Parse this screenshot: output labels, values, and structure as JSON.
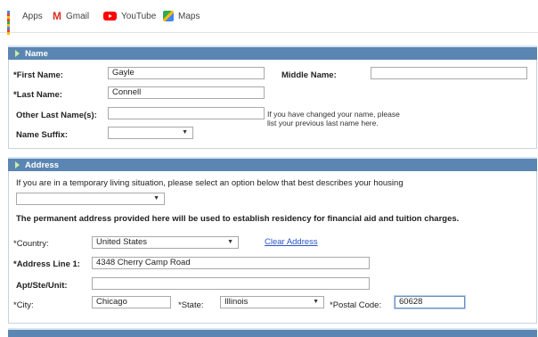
{
  "bookmarks": [
    {
      "label": "Apps",
      "icon": "apps-grid-icon"
    },
    {
      "label": "Gmail",
      "icon": "gmail-icon"
    },
    {
      "label": "YouTube",
      "icon": "youtube-icon"
    },
    {
      "label": "Maps",
      "icon": "maps-icon"
    }
  ],
  "name_section": {
    "title": "Name",
    "first_name_label": "*First Name:",
    "first_name_value": "Gayle",
    "middle_name_label": "Middle Name:",
    "middle_name_value": "",
    "last_name_label": "*Last Name:",
    "last_name_value": "Connell",
    "other_last_names_label": "Other Last Name(s):",
    "other_last_names_value": "",
    "other_last_names_note_line1": "If you have changed your name, please",
    "other_last_names_note_line2": "list your previous last name here.",
    "suffix_label": "Name Suffix:",
    "suffix_value": ""
  },
  "address_section": {
    "title": "Address",
    "temporary_prompt": "If you are in a temporary living situation, please select an option below that best describes your housing",
    "temporary_value": "",
    "residency_note": "The permanent address provided here will be used to establish residency for financial aid and tuition charges.",
    "country_label": "*Country:",
    "country_value": "United States",
    "clear_address_link": "Clear Address",
    "address_line1_label": "*Address Line 1:",
    "address_line1_value": "4348  Cherry Camp Road",
    "apt_label": "Apt/Ste/Unit:",
    "apt_value": "",
    "city_label": "*City:",
    "city_value": "Chicago",
    "state_label": "*State:",
    "state_value": "Illinois",
    "postal_label": "*Postal Code:",
    "postal_value": "60628"
  },
  "colors": {
    "section_header_bg": "#5b86b3",
    "link": "#2a55c9"
  }
}
